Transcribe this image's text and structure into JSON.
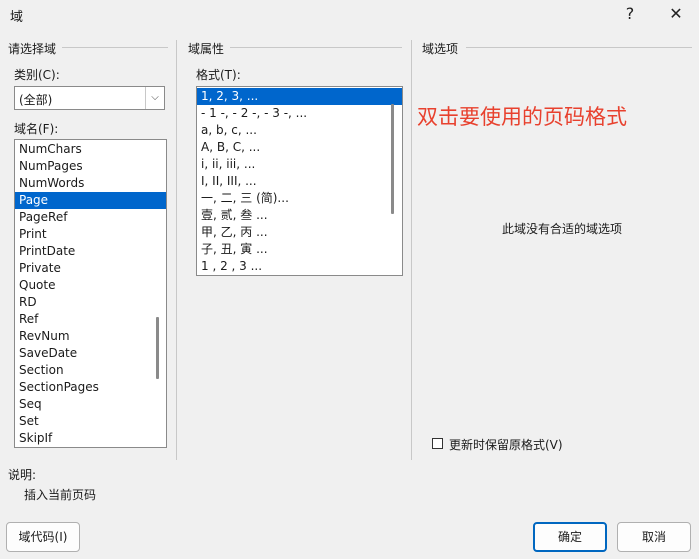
{
  "window": {
    "title": "域",
    "help_icon": "?",
    "close_icon": "✕"
  },
  "left": {
    "section_title": "请选择域",
    "category_label": "类别(C):",
    "category_value": "(全部)",
    "fieldnames_label": "域名(F):",
    "fields": [
      "NumChars",
      "NumPages",
      "NumWords",
      "Page",
      "PageRef",
      "Print",
      "PrintDate",
      "Private",
      "Quote",
      "RD",
      "Ref",
      "RevNum",
      "SaveDate",
      "Section",
      "SectionPages",
      "Seq",
      "Set",
      "SkipIf"
    ],
    "selected_field": "Page"
  },
  "middle": {
    "section_title": "域属性",
    "format_label": "格式(T):",
    "formats": [
      "1, 2, 3, ...",
      "- 1 -, - 2 -, - 3 -, ...",
      "a, b, c, ...",
      "A, B, C, ...",
      "i, ii, iii, ...",
      "I, II, III, ...",
      "一, 二, 三 (简)...",
      "壹, 贰, 叁 ...",
      "甲, 乙, 丙 ...",
      "子, 丑, 寅 ...",
      "1 , 2 , 3  ..."
    ],
    "selected_format": "1, 2, 3, ..."
  },
  "right": {
    "section_title": "域选项",
    "annotation": "双击要使用的页码格式",
    "no_options": "此域没有合适的域选项",
    "preserve_label": "更新时保留原格式(V)"
  },
  "description": {
    "label": "说明:",
    "text": "插入当前页码"
  },
  "buttons": {
    "field_codes": "域代码(I)",
    "ok": "确定",
    "cancel": "取消"
  }
}
